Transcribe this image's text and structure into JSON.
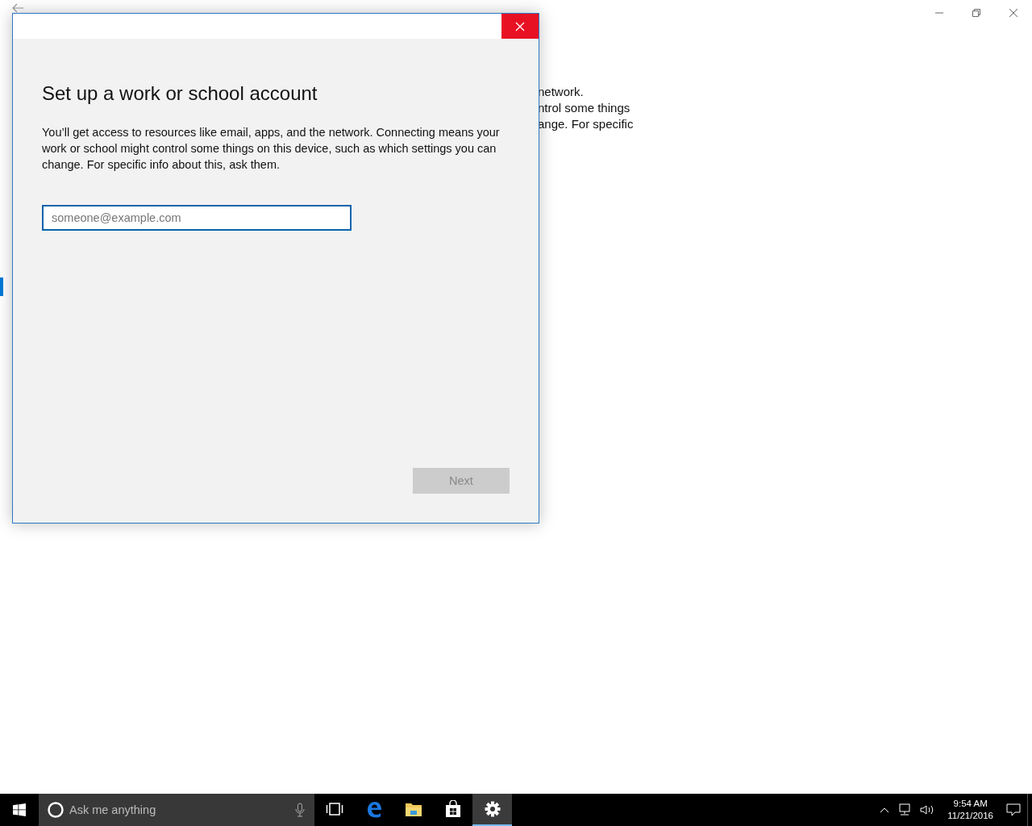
{
  "background_window": {
    "text_lines": [
      "network.",
      "ntrol some things",
      "ange. For specific"
    ]
  },
  "dialog": {
    "title": "Set up a work or school account",
    "description": "You’ll get access to resources like email, apps, and the network. Connecting means your work or school might control some things on this device, such as which settings you can change. For specific info about this, ask them.",
    "email_field": {
      "placeholder": "someone@example.com"
    },
    "next_button": {
      "label": "Next",
      "disabled": true
    }
  },
  "taskbar": {
    "search": {
      "placeholder": "Ask me anything"
    },
    "apps": [
      {
        "kind": "task-view",
        "selected": false
      },
      {
        "kind": "edge",
        "selected": false
      },
      {
        "kind": "explorer",
        "selected": false
      },
      {
        "kind": "store",
        "selected": false
      },
      {
        "kind": "settings",
        "selected": true
      }
    ],
    "clock": {
      "time": "9:54 AM",
      "date": "11/21/2016"
    }
  }
}
